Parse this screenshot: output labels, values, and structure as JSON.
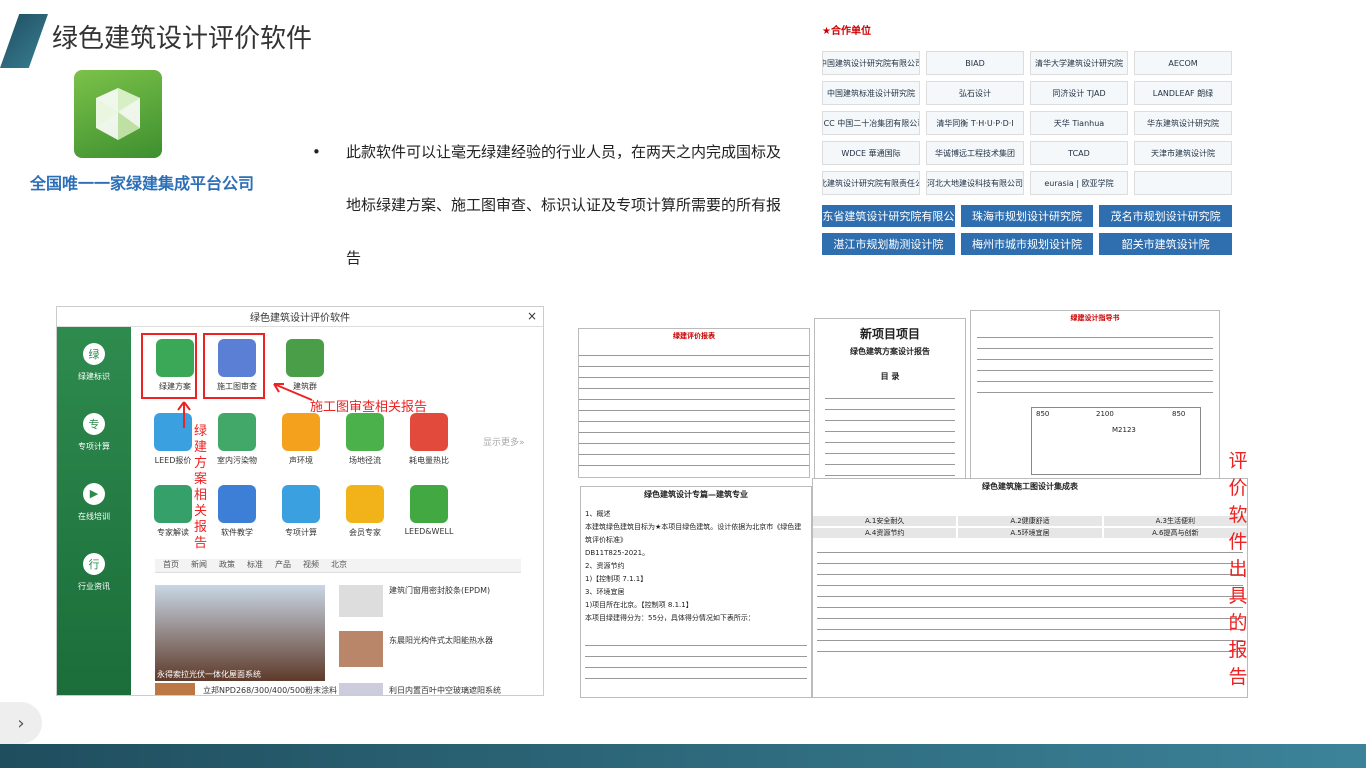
{
  "title": "绿色建筑设计评价软件",
  "tagline": "全国唯一一家绿建集成平台公司",
  "description": "此款软件可以让毫无绿建经验的行业人员，在两天之内完成国标及地标绿建方案、施工图审查、标识认证及专项计算所需要的所有报告",
  "bullet": "•",
  "partners_title": "★合作单位",
  "partners": [
    "中国建筑设计研究院有限公司",
    "BIAD",
    "清华大学建筑设计研究院",
    "AECOM",
    "中国建筑标准设计研究院",
    "弘石设计",
    "同济设计 TJAD",
    "LANDLEAF 朗绿",
    "MCC 中国二十冶集团有限公司",
    "清华同衡 T·H·U·P·D·I",
    "天华 Tianhua",
    "华东建筑设计研究院",
    "WDCE 華通国际",
    "华诚博远工程技术集团",
    "TCAD",
    "天津市建筑设计院",
    "河北建筑设计研究院有限责任公司",
    "河北大地建设科技有限公司",
    "eurasia | 欧亚学院",
    ""
  ],
  "partners2": [
    "广东省建筑设计研究院有限公司",
    "珠海市规划设计研究院",
    "茂名市规划设计研究院",
    "湛江市规划勘测设计院",
    "梅州市城市规划设计院",
    "韶关市建筑设计院"
  ],
  "app": {
    "title": "绿色建筑设计评价软件",
    "close": "×",
    "side": [
      {
        "icon": "绿",
        "label": "绿建标识"
      },
      {
        "icon": "专",
        "label": "专项计算"
      },
      {
        "icon": "▶",
        "label": "在线培训"
      },
      {
        "icon": "行",
        "label": "行业资讯"
      }
    ],
    "items": [
      "绿建方案",
      "施工图审查",
      "建筑群",
      "LEED报价",
      "室内污染物",
      "声环境",
      "场地径流",
      "耗电量热比",
      "专家解读",
      "软件教学",
      "专项计算",
      "会员专家",
      "LEED&WELL"
    ],
    "more": "显示更多»",
    "tabs": [
      "首页",
      "新闻",
      "政策",
      "标准",
      "产品",
      "视频",
      "北京"
    ],
    "news": [
      "建筑门窗用密封胶条(EPDM)",
      "东晨阳光构件式太阳能热水器",
      "永得索拉光伏一体化屋面系统",
      "立邦NPD268/300/400/500粉末涂料",
      "利日内置百叶中空玻璃遮阳系统"
    ]
  },
  "ann1": "施工图审查相关报告",
  "ann2": "绿建方案相关报告",
  "ann3": "评价软件出具的报告",
  "docs": {
    "d1": "绿建评价报表",
    "d2a": "新项目项目",
    "d2b": "绿色建筑方案设计报告",
    "d2c": "目 录",
    "d3a": "绿建设计指导书",
    "d3dims": [
      "2100",
      "850",
      "850",
      "M2123"
    ],
    "d4": "绿色建筑设计专篇—建筑专业",
    "d4body": [
      "1、概述",
      "本建筑绿色建筑目标为★本项目绿色建筑。设计依据为北京市《绿色建筑评价标准》",
      "DB11T825-2021。",
      "2、资源节约",
      "1)【控制项 7.1.1】",
      "3、环境宜居",
      "1)项目所在北京。【控制项 8.1.1】",
      "本项目绿建得分为：55分，具体得分情况如下表所示："
    ],
    "d5": "绿色建筑施工图设计集成表",
    "d5rows": [
      "A.1安全耐久",
      "A.2健康舒适",
      "A.3生活便利",
      "A.4资源节约",
      "A.5环境宜居",
      "A.6提高与创新"
    ]
  }
}
